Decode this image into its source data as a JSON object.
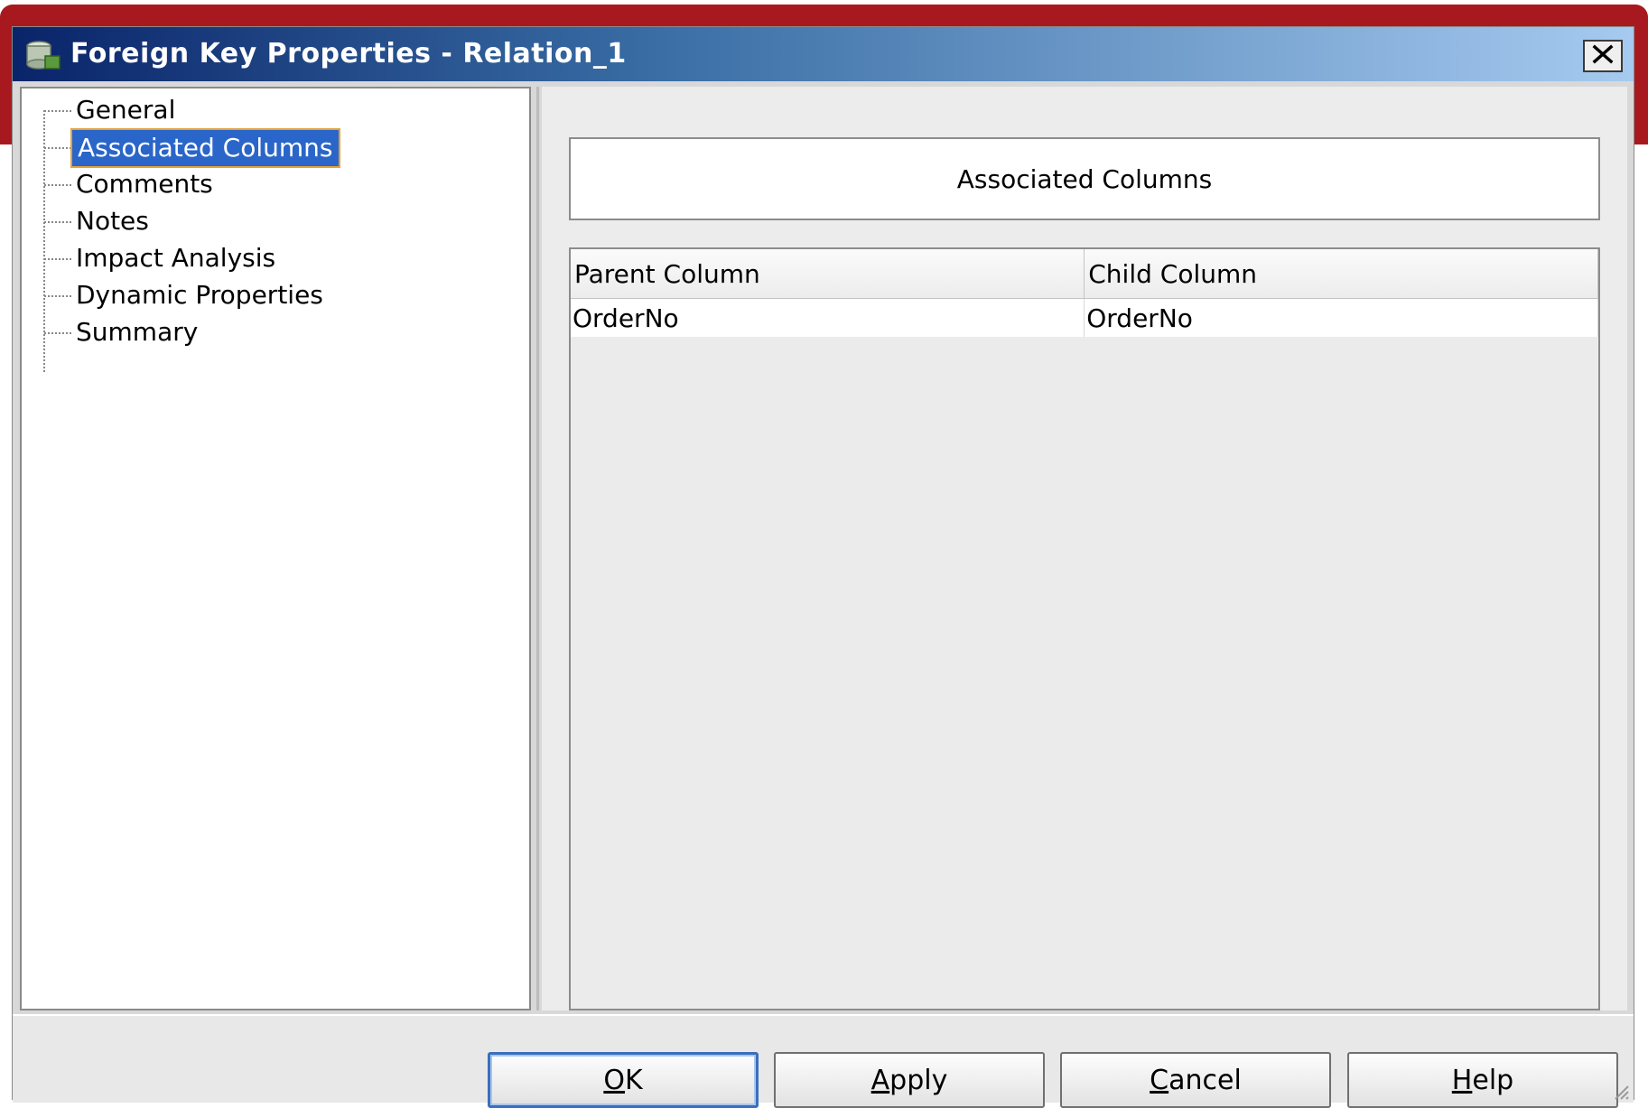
{
  "window": {
    "title": "Foreign Key Properties - Relation_1",
    "close_label": "✕"
  },
  "nav_tree": {
    "items": [
      {
        "label": "General",
        "selected": false
      },
      {
        "label": "Associated Columns",
        "selected": true
      },
      {
        "label": "Comments",
        "selected": false
      },
      {
        "label": "Notes",
        "selected": false
      },
      {
        "label": "Impact Analysis",
        "selected": false
      },
      {
        "label": "Dynamic Properties",
        "selected": false
      },
      {
        "label": "Summary",
        "selected": false
      }
    ]
  },
  "panel": {
    "heading": "Associated Columns",
    "table": {
      "headers": [
        "Parent Column",
        "Child Column"
      ],
      "rows": [
        [
          "OrderNo",
          "OrderNo"
        ]
      ]
    }
  },
  "buttons": {
    "ok": {
      "mnemonic": "O",
      "rest": "K"
    },
    "apply": {
      "mnemonic": "A",
      "rest": "pply"
    },
    "cancel": {
      "mnemonic": "C",
      "rest": "ancel"
    },
    "help": {
      "mnemonic": "H",
      "rest": "elp"
    }
  },
  "colors": {
    "selection": "#2a66c9",
    "selection_border": "#e8a13a",
    "titlebar_start": "#0a246a",
    "titlebar_end": "#a6caf0",
    "frame_accent": "#a8191f"
  },
  "icons": {
    "app": "database-icon",
    "close": "close-icon",
    "grip": "resize-grip-icon"
  }
}
